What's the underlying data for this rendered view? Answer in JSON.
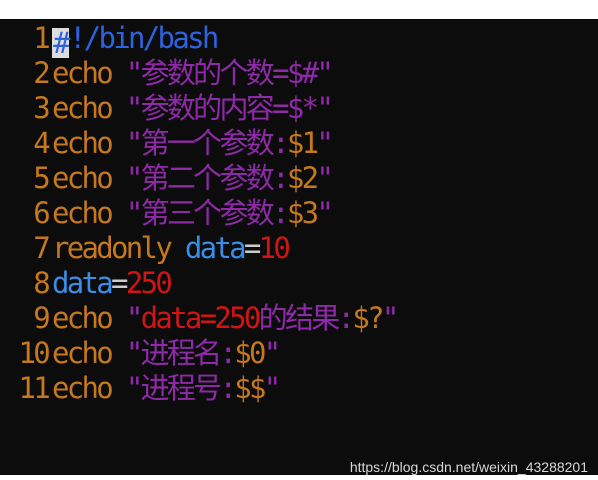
{
  "editor": {
    "background": "#0c0c0c",
    "colors": {
      "line_number": "#c5781e",
      "keyword": "#c5781e",
      "string": "#8e2aa8",
      "variable": "#3a8ee6",
      "number": "#d01515",
      "shebang": "#2e63e0"
    },
    "lines": [
      {
        "num": "1",
        "segments": [
          {
            "text": "#",
            "type": "cursor"
          },
          {
            "text": "!/bin/bash",
            "type": "shebang"
          }
        ]
      },
      {
        "num": "2",
        "segments": [
          {
            "text": "echo ",
            "type": "kw"
          },
          {
            "text": "\"参数的个数=$#\"",
            "type": "str"
          }
        ]
      },
      {
        "num": "3",
        "segments": [
          {
            "text": "echo ",
            "type": "kw"
          },
          {
            "text": "\"参数的内容=$*\"",
            "type": "str"
          }
        ]
      },
      {
        "num": "4",
        "segments": [
          {
            "text": "echo ",
            "type": "kw"
          },
          {
            "text": "\"第一个参数:",
            "type": "str"
          },
          {
            "text": "$1",
            "type": "kw"
          },
          {
            "text": "\"",
            "type": "str"
          }
        ]
      },
      {
        "num": "5",
        "segments": [
          {
            "text": "echo ",
            "type": "kw"
          },
          {
            "text": "\"第二个参数:",
            "type": "str"
          },
          {
            "text": "$2",
            "type": "kw"
          },
          {
            "text": "\"",
            "type": "str"
          }
        ]
      },
      {
        "num": "6",
        "segments": [
          {
            "text": "echo ",
            "type": "kw"
          },
          {
            "text": "\"第三个参数:",
            "type": "str"
          },
          {
            "text": "$3",
            "type": "kw"
          },
          {
            "text": "\"",
            "type": "str"
          }
        ]
      },
      {
        "num": "7",
        "segments": [
          {
            "text": "readonly ",
            "type": "kw"
          },
          {
            "text": "data",
            "type": "var"
          },
          {
            "text": "=",
            "type": "op"
          },
          {
            "text": "10",
            "type": "num"
          }
        ]
      },
      {
        "num": "8",
        "segments": [
          {
            "text": "data",
            "type": "var"
          },
          {
            "text": "=",
            "type": "op"
          },
          {
            "text": "250",
            "type": "num"
          }
        ]
      },
      {
        "num": "9",
        "segments": [
          {
            "text": "echo ",
            "type": "kw"
          },
          {
            "text": "\"",
            "type": "str"
          },
          {
            "text": "data=250",
            "type": "num"
          },
          {
            "text": "的结果:",
            "type": "str"
          },
          {
            "text": "$?",
            "type": "kw"
          },
          {
            "text": "\"",
            "type": "str"
          }
        ]
      },
      {
        "num": "10",
        "segments": [
          {
            "text": "echo ",
            "type": "kw"
          },
          {
            "text": "\"进程名:",
            "type": "str"
          },
          {
            "text": "$0",
            "type": "kw"
          },
          {
            "text": "\"",
            "type": "str"
          }
        ]
      },
      {
        "num": "11",
        "segments": [
          {
            "text": "echo ",
            "type": "kw"
          },
          {
            "text": "\"进程号:",
            "type": "str"
          },
          {
            "text": "$$",
            "type": "kw"
          },
          {
            "text": "\"",
            "type": "str"
          }
        ]
      }
    ]
  },
  "watermark": "https://blog.csdn.net/weixin_43288201"
}
